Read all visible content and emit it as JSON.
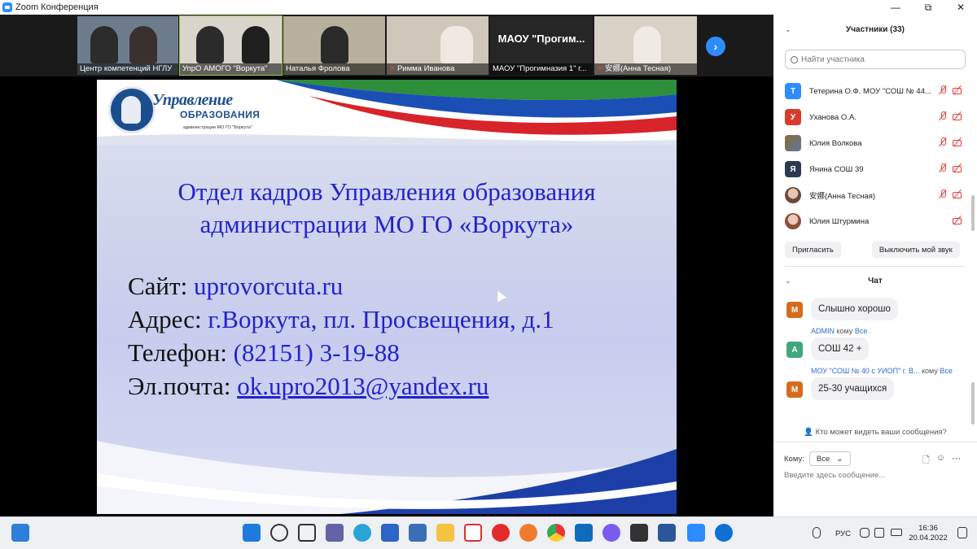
{
  "window": {
    "title": "Zoom Конференция",
    "controls": [
      "—",
      "⧉",
      "✕"
    ]
  },
  "gallery": {
    "tiles": [
      {
        "name": "Центр компетенций НГЛУ",
        "muted": false,
        "text": ""
      },
      {
        "name": "УпрО АМОГО \"Воркута\"",
        "muted": false,
        "text": ""
      },
      {
        "name": "Наталья Фролова",
        "muted": false,
        "text": ""
      },
      {
        "name": "Римма Иванова",
        "muted": true,
        "text": ""
      },
      {
        "name": "МАОУ \"Прогимназия 1\" г...",
        "muted": false,
        "text": "МАОУ  \"Прогим..."
      },
      {
        "name": "安娜(Анна Тесная)",
        "muted": true,
        "text": ""
      }
    ],
    "next_icon": "chevron-right-icon"
  },
  "slide": {
    "logo": {
      "line1": "Управление",
      "line2": "ОБРАЗОВАНИЯ",
      "line3": "администрации МО ГО \"Воркута\""
    },
    "heading_line1": "Отдел кадров Управления образования",
    "heading_line2": "администрации МО ГО «Воркута»",
    "site_label": "Сайт:",
    "site_value": "uprovorcuta.ru",
    "address_label": "Адрес:",
    "address_value": "г.Воркута, пл. Просвещения, д.1",
    "phone_label": "Телефон:",
    "phone_value": "(82151) 3-19-88",
    "email_label": "Эл.почта:",
    "email_value": "ok.upro2013@yandex.ru"
  },
  "participants": {
    "title": "Участники (33)",
    "search_placeholder": "Найти участника",
    "list": [
      {
        "initial": "Т",
        "color": "#2d8cff",
        "name": "Тетерина О.Ф. МОУ \"СОШ № 44...",
        "mic_off": true,
        "cam_off": true
      },
      {
        "initial": "У",
        "color": "#d93a2b",
        "name": "Уханова О.А.",
        "mic_off": true,
        "cam_off": true
      },
      {
        "initial": "",
        "color": "#8a6a3a",
        "name": "Юлия Волкова",
        "mic_off": true,
        "cam_off": true
      },
      {
        "initial": "Я",
        "color": "#2e3a4f",
        "name": "Янина СОШ 39",
        "mic_off": true,
        "cam_off": true
      },
      {
        "initial": "",
        "color": "#b98b6e",
        "name": "安娜(Анна Тесная)",
        "mic_off": true,
        "cam_off": true
      },
      {
        "initial": "",
        "color": "#a5684f",
        "name": "Юлия Штурмина",
        "mic_off": false,
        "cam_off": true
      }
    ],
    "invite_label": "Пригласить",
    "mute_label": "Выключить мой звук"
  },
  "chat": {
    "title": "Чат",
    "messages": [
      {
        "sender": "",
        "to": "",
        "initial": "М",
        "color": "#d86a1c",
        "text": "Слышно хорошо"
      },
      {
        "sender": "ADMIN",
        "to": "Все",
        "initial": "А",
        "color": "#3fa77a",
        "text": "СОШ 42 +"
      },
      {
        "sender": "МОУ \"СОШ № 40 с УИОП\" г. В...",
        "to": "Все",
        "initial": "М",
        "color": "#d86a1c",
        "text": "25-30 учащихся"
      }
    ],
    "to_word": "кому",
    "who_can_see": "Кто может видеть ваши сообщения?",
    "to_label": "Кому:",
    "to_value": "Все",
    "input_placeholder": "Введите здесь сообщение..."
  },
  "taskbar": {
    "lang": "РУС",
    "time": "16:36",
    "date": "20.04.2022"
  }
}
